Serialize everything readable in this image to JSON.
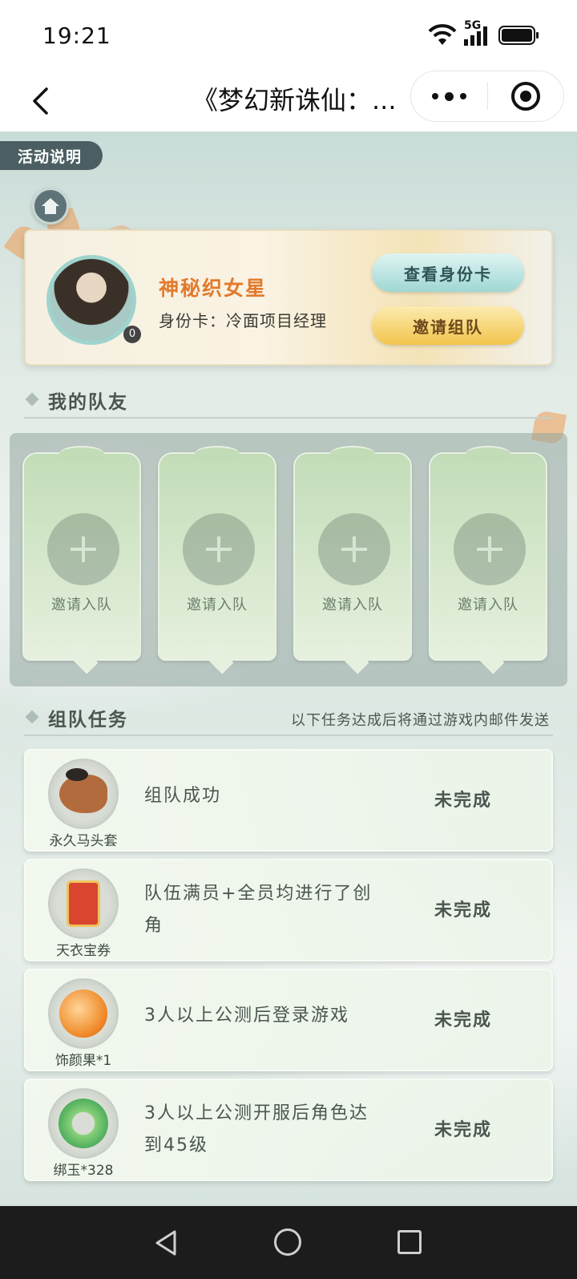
{
  "status_bar": {
    "time": "19:21",
    "network": "5G"
  },
  "nav": {
    "title": "《梦幻新诛仙：..."
  },
  "activity": {
    "label": "活动说明"
  },
  "profile": {
    "badge": "0",
    "name": "神秘织女星",
    "identity": "身份卡：冷面项目经理",
    "view_card_label": "查看身份卡",
    "invite_team_label": "邀请组队"
  },
  "teammates": {
    "title": "我的队友",
    "slots": [
      {
        "label": "邀请入队"
      },
      {
        "label": "邀请入队"
      },
      {
        "label": "邀请入队"
      },
      {
        "label": "邀请入队"
      }
    ]
  },
  "tasks": {
    "title": "组队任务",
    "note": "以下任务达成后将通过游戏内邮件发送",
    "items": [
      {
        "reward": "永久马头套",
        "icon": "horse-head-icon",
        "desc": "组队成功",
        "state": "未完成"
      },
      {
        "reward": "天衣宝券",
        "icon": "voucher-icon",
        "desc": "队伍满员+全员均进行了创角",
        "state": "未完成"
      },
      {
        "reward": "饰颜果*1",
        "icon": "fruit-icon",
        "desc": "3人以上公测后登录游戏",
        "state": "未完成"
      },
      {
        "reward": "绑玉*328",
        "icon": "jade-icon",
        "desc": "3人以上公测开服后角色达到45级",
        "state": "未完成"
      }
    ]
  },
  "colors": {
    "accent_name": "#e27a2c",
    "button_teal": "#9fd7d3",
    "button_gold": "#f2c44b",
    "panel": "#94a6a0"
  }
}
